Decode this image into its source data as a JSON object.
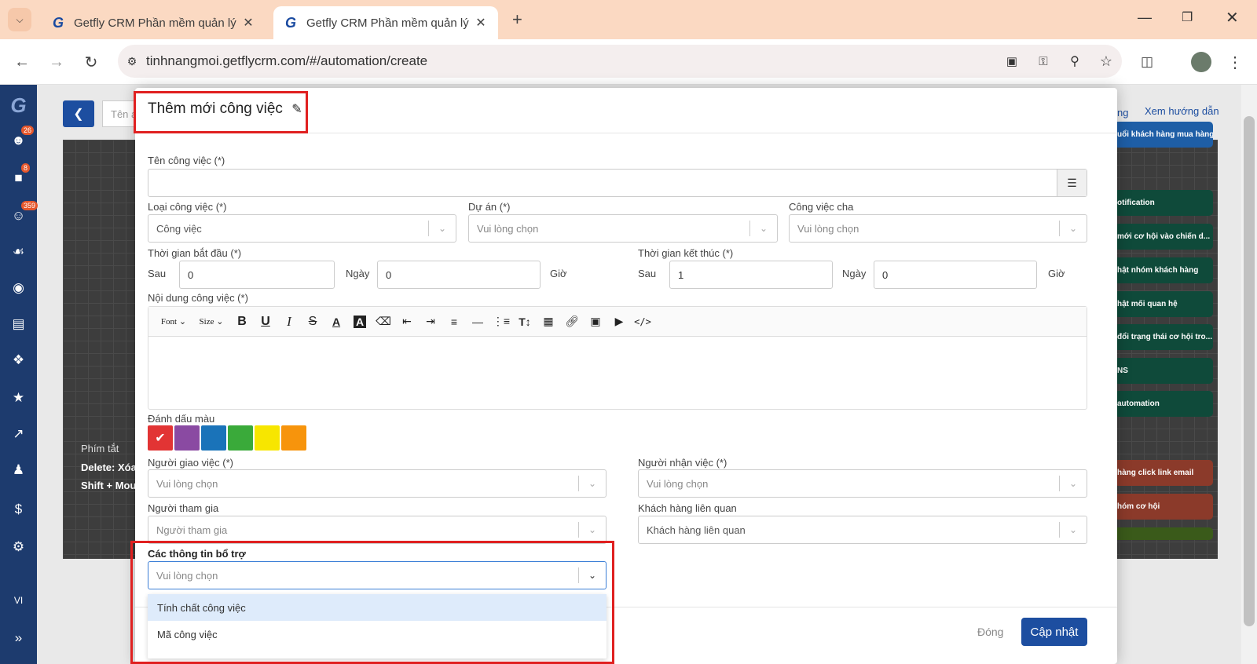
{
  "browser": {
    "tabs": [
      {
        "title": "Getfly CRM Phần mềm quản lý"
      },
      {
        "title": "Getfly CRM Phần mềm quản lý"
      }
    ],
    "url": "tinhnangmoi.getflycrm.com/#/automation/create",
    "menu_icon": "chevron-down-icon"
  },
  "sidebar": {
    "badges": [
      "26",
      "8",
      "359"
    ],
    "language": "VI"
  },
  "background": {
    "back_label": "Tên a",
    "help_link": "Xem hướng dẫn",
    "tab_partial": "ng",
    "shortcuts_title": "Phím tắt",
    "shortcut_delete": "Delete: Xóa",
    "shortcut_shift": "Shift + Mou",
    "nodes": [
      {
        "label": "uổi khách hàng mua hàng",
        "color": "#1e5ea6"
      },
      {
        "label": "otification",
        "color": "#0f4a3a"
      },
      {
        "label": "mới cơ hội vào chiến d...",
        "color": "#0f4a3a"
      },
      {
        "label": "hật nhóm khách hàng",
        "color": "#0f4a3a"
      },
      {
        "label": "hật mối quan hệ",
        "color": "#0f4a3a"
      },
      {
        "label": "đổi trạng thái cơ hội tro...",
        "color": "#0f4a3a"
      },
      {
        "label": "NS",
        "color": "#0f4a3a"
      },
      {
        "label": "automation",
        "color": "#0f4a3a"
      },
      {
        "label": "hàng click link email",
        "color": "#8b3a2a"
      },
      {
        "label": "hóm cơ hội",
        "color": "#8b3a2a"
      },
      {
        "label": "",
        "color": "#3a5a1a"
      }
    ]
  },
  "modal": {
    "title": "Thêm mới công việc",
    "task_name_label": "Tên công việc (*)",
    "task_name_value": "",
    "task_type_label": "Loại công việc (*)",
    "task_type_value": "Công việc",
    "project_label": "Dự án (*)",
    "project_placeholder": "Vui lòng chọn",
    "parent_label": "Công việc cha",
    "parent_placeholder": "Vui lòng chọn",
    "start_label": "Thời gian bắt đầu (*)",
    "start_after": "Sau",
    "start_days": "0",
    "start_day_unit": "Ngày",
    "start_hours": "0",
    "start_hour_unit": "Giờ",
    "end_label": "Thời gian kết thúc (*)",
    "end_after": "Sau",
    "end_days": "1",
    "end_day_unit": "Ngày",
    "end_hours": "0",
    "end_hour_unit": "Giờ",
    "content_label": "Nội dung công việc (*)",
    "toolbar": {
      "font": "Font",
      "size": "Size",
      "buttons": [
        "bold-icon",
        "underline-icon",
        "italic-icon",
        "strikethrough-icon",
        "font-color-icon",
        "highlight-icon",
        "eraser-icon",
        "outdent-icon",
        "indent-icon",
        "align-icon",
        "horizontal-rule-icon",
        "ordered-list-icon",
        "text-size-icon",
        "table-icon",
        "link-icon",
        "image-icon",
        "video-icon",
        "code-icon"
      ]
    },
    "color_label": "Đánh dấu màu",
    "colors": [
      "#e23434",
      "#8a4aa2",
      "#1a73b9",
      "#3aaa3a",
      "#f7e600",
      "#f7940c"
    ],
    "assigner_label": "Người giao việc (*)",
    "assigner_placeholder": "Vui lòng chọn",
    "assignee_label": "Người nhận việc (*)",
    "assignee_placeholder": "Vui lòng chọn",
    "participants_label": "Người tham gia",
    "participants_placeholder": "Người tham gia",
    "customers_label": "Khách hàng liên quan",
    "customers_placeholder": "Khách hàng liên quan",
    "extra_label": "Các thông tin bổ trợ",
    "extra_placeholder": "Vui lòng chọn",
    "extra_options": [
      "Tính chất công việc",
      "Mã công việc"
    ],
    "close_label": "Đóng",
    "update_label": "Cập nhật"
  }
}
